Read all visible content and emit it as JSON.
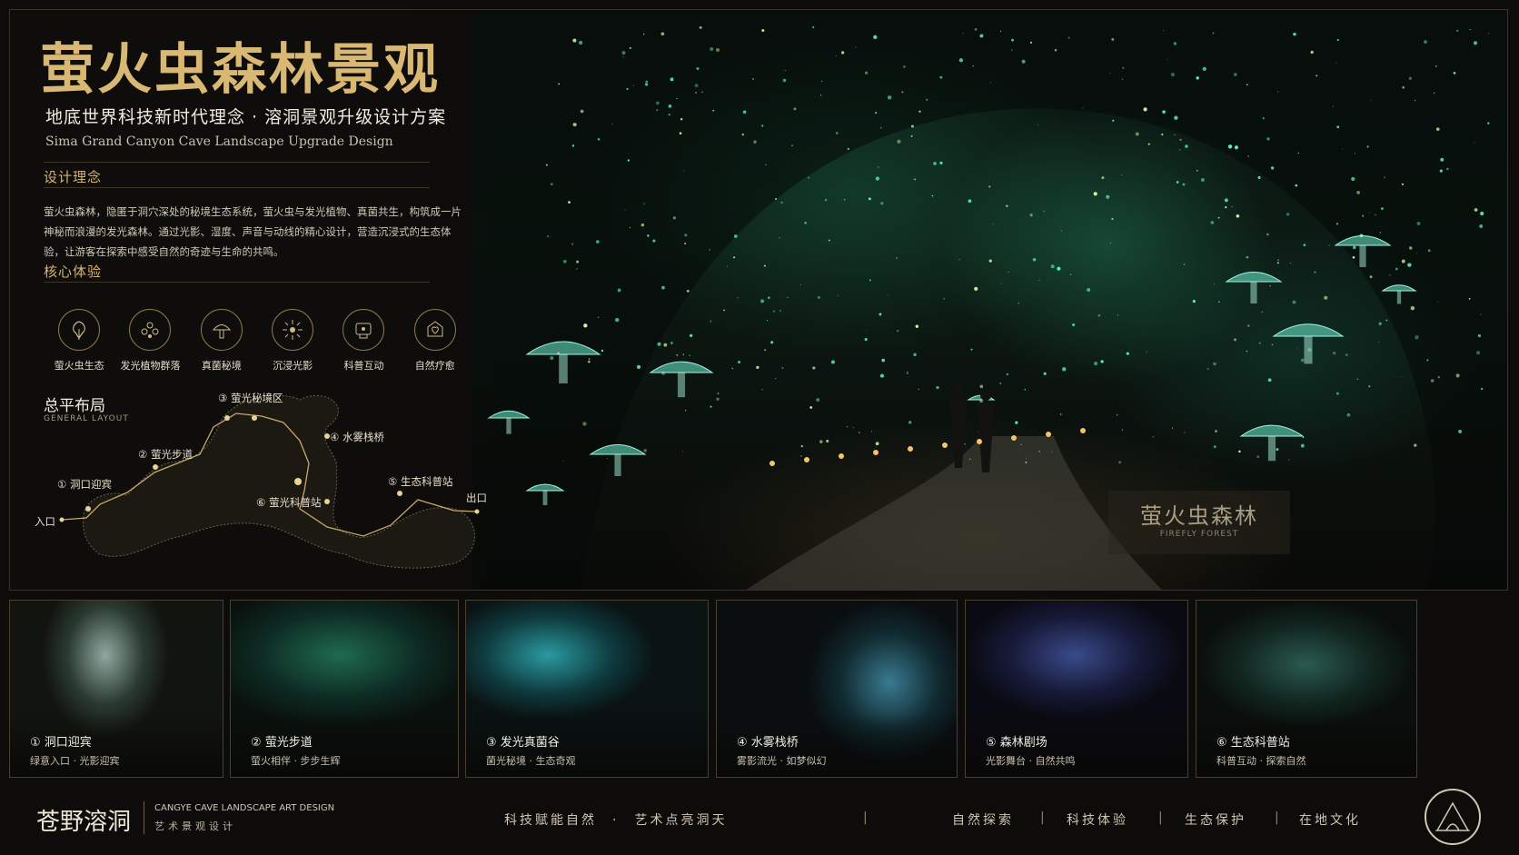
{
  "title": "萤火虫森林景观",
  "subtitle": "地底世界科技新时代理念 · 溶洞景观升级设计方案",
  "subtitle_en": "Sima Grand Canyon Cave Landscape Upgrade Design",
  "concept": {
    "heading": "设计理念",
    "text": "萤火虫森林，隐匿于洞穴深处的秘境生态系统，萤火虫与发光植物、真菌共生，构筑成一片神秘而浪漫的发光森林。通过光影、湿度、声音与动线的精心设计，营造沉浸式的生态体验，让游客在探索中感受自然的奇迹与生命的共鸣。"
  },
  "core": {
    "heading": "核心体验",
    "items": [
      {
        "label": "萤火虫生态",
        "icon": "firefly-tree-icon"
      },
      {
        "label": "发光植物群落",
        "icon": "glowing-plants-icon"
      },
      {
        "label": "真菌秘境",
        "icon": "mushroom-icon"
      },
      {
        "label": "沉浸光影",
        "icon": "light-rays-icon"
      },
      {
        "label": "科普互动",
        "icon": "interaction-icon"
      },
      {
        "label": "自然疗愈",
        "icon": "healing-icon"
      }
    ]
  },
  "layout": {
    "heading": "总平布局",
    "heading_en": "GENERAL LAYOUT",
    "pins": {
      "p3": "③ 萤光秘境区",
      "p4": "④ 水雾栈桥",
      "p2": "② 萤光步道",
      "p1": "① 洞口迎宾",
      "p5": "⑤ 生态科普站",
      "p6": "⑥ 萤光科普站",
      "exit": "出口",
      "entry": "入口"
    }
  },
  "hero": {
    "stamp_cn": "萤火虫森林",
    "stamp_en": "FIREFLY FOREST"
  },
  "thumbs": [
    {
      "caption": "① 洞口迎宾",
      "sub": "绿意入口 · 光影迎宾"
    },
    {
      "caption": "② 萤光步道",
      "sub": "萤火相伴 · 步步生辉"
    },
    {
      "caption": "③ 发光真菌谷",
      "sub": "菌光秘境 · 生态奇观"
    },
    {
      "caption": "④ 水雾栈桥",
      "sub": "雾影流光 · 如梦似幻"
    },
    {
      "caption": "⑤ 森林剧场",
      "sub": "光影舞台 · 自然共鸣"
    },
    {
      "caption": "⑥ 生态科普站",
      "sub": "科普互动 · 探索自然"
    }
  ],
  "footer": {
    "brand": "苍野溶洞",
    "brand_en": "CANGYE CAVE LANDSCAPE ART DESIGN",
    "brand_cn": "艺术景观设计",
    "slogan": "科技赋能自然　·　艺术点亮洞天",
    "tags": [
      "自然探索",
      "科技体验",
      "生态保护",
      "在地文化"
    ]
  },
  "colors": {
    "gold": "#d9b873",
    "glow": "#4fe3b0",
    "bg": "#0d0c0a"
  }
}
